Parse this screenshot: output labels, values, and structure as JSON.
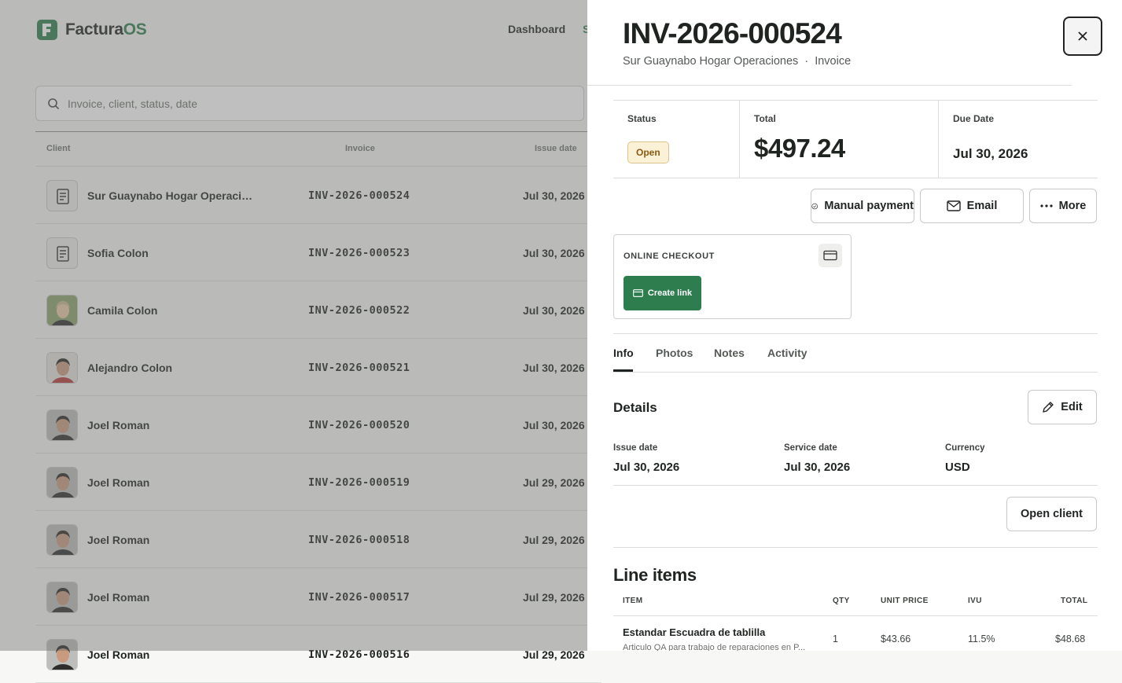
{
  "app": {
    "name_main": "Factura",
    "name_accent": "OS"
  },
  "nav": {
    "items": [
      "Dashboard",
      "S"
    ]
  },
  "search": {
    "placeholder": "Invoice, client, status, date"
  },
  "table": {
    "headers": {
      "client": "Client",
      "invoice": "Invoice",
      "issue_date": "Issue date"
    },
    "rows": [
      {
        "client": "Sur Guaynabo Hogar Operaciones",
        "invoice": "INV-2026-000524",
        "issue_date": "Jul 30, 2026",
        "avatar": "document-icon"
      },
      {
        "client": "Sofia Colon",
        "invoice": "INV-2026-000523",
        "issue_date": "Jul 30, 2026",
        "avatar": "document-icon"
      },
      {
        "client": "Camila Colon",
        "invoice": "INV-2026-000522",
        "issue_date": "Jul 30, 2026",
        "avatar": "photo"
      },
      {
        "client": "Alejandro Colon",
        "invoice": "INV-2026-000521",
        "issue_date": "Jul 30, 2026",
        "avatar": "photo"
      },
      {
        "client": "Joel Roman",
        "invoice": "INV-2026-000520",
        "issue_date": "Jul 30, 2026",
        "avatar": "photo"
      },
      {
        "client": "Joel Roman",
        "invoice": "INV-2026-000519",
        "issue_date": "Jul 29, 2026",
        "avatar": "photo"
      },
      {
        "client": "Joel Roman",
        "invoice": "INV-2026-000518",
        "issue_date": "Jul 29, 2026",
        "avatar": "photo"
      },
      {
        "client": "Joel Roman",
        "invoice": "INV-2026-000517",
        "issue_date": "Jul 29, 2026",
        "avatar": "photo"
      },
      {
        "client": "Joel Roman",
        "invoice": "INV-2026-000516",
        "issue_date": "Jul 29, 2026",
        "avatar": "photo"
      }
    ]
  },
  "panel": {
    "title": "INV-2026-000524",
    "client": "Sur Guaynabo Hogar Operaciones",
    "separator": "·",
    "doc_type": "Invoice",
    "summary": {
      "status_label": "Status",
      "status_value": "Open",
      "total_label": "Total",
      "total_value": "$497.24",
      "due_label": "Due Date",
      "due_value": "Jul 30, 2026"
    },
    "actions": {
      "manual_payment": "Manual payment",
      "email": "Email",
      "more": "More"
    },
    "checkout": {
      "label": "ONLINE CHECKOUT",
      "create_link": "Create link"
    },
    "tabs": [
      "Info",
      "Photos",
      "Notes",
      "Activity"
    ],
    "active_tab": "Info",
    "details": {
      "heading": "Details",
      "edit": "Edit",
      "issue_label": "Issue date",
      "issue_value": "Jul 30, 2026",
      "service_label": "Service date",
      "service_value": "Jul 30, 2026",
      "currency_label": "Currency",
      "currency_value": "USD",
      "open_client": "Open client"
    },
    "line_items": {
      "heading": "Line items",
      "headers": {
        "item": "ITEM",
        "qty": "QTY",
        "unit_price": "UNIT PRICE",
        "ivu": "IVU",
        "total": "TOTAL"
      },
      "rows": [
        {
          "name": "Estandar Escuadra de tablilla",
          "description": "Articulo QA para trabajo de reparaciones en P...",
          "qty": "1",
          "unit_price": "$43.66",
          "ivu": "11.5%",
          "total": "$48.68"
        }
      ]
    }
  },
  "colors": {
    "brand": "#2e7d4f",
    "badge_open_bg": "#fbf1d6",
    "badge_open_text": "#8a5a12"
  }
}
